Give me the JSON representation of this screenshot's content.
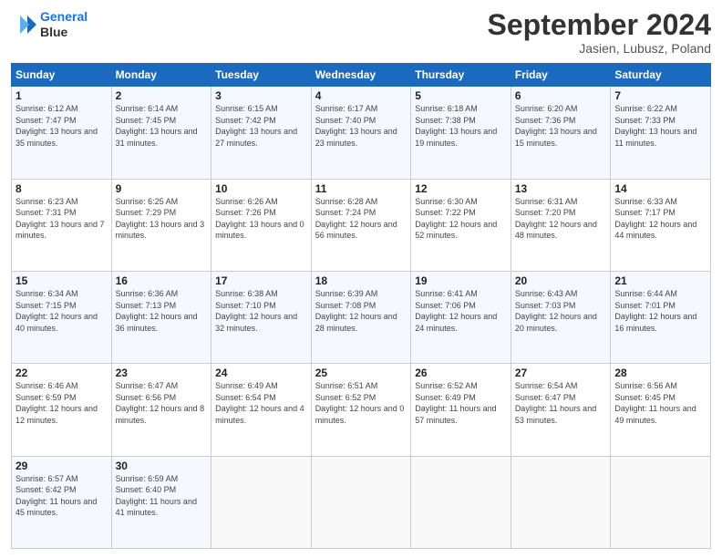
{
  "header": {
    "logo_line1": "General",
    "logo_line2": "Blue",
    "month": "September 2024",
    "location": "Jasien, Lubusz, Poland"
  },
  "days_of_week": [
    "Sunday",
    "Monday",
    "Tuesday",
    "Wednesday",
    "Thursday",
    "Friday",
    "Saturday"
  ],
  "weeks": [
    [
      {
        "day": "1",
        "sunrise": "6:12 AM",
        "sunset": "7:47 PM",
        "daylight": "13 hours and 35 minutes."
      },
      {
        "day": "2",
        "sunrise": "6:14 AM",
        "sunset": "7:45 PM",
        "daylight": "13 hours and 31 minutes."
      },
      {
        "day": "3",
        "sunrise": "6:15 AM",
        "sunset": "7:42 PM",
        "daylight": "13 hours and 27 minutes."
      },
      {
        "day": "4",
        "sunrise": "6:17 AM",
        "sunset": "7:40 PM",
        "daylight": "13 hours and 23 minutes."
      },
      {
        "day": "5",
        "sunrise": "6:18 AM",
        "sunset": "7:38 PM",
        "daylight": "13 hours and 19 minutes."
      },
      {
        "day": "6",
        "sunrise": "6:20 AM",
        "sunset": "7:36 PM",
        "daylight": "13 hours and 15 minutes."
      },
      {
        "day": "7",
        "sunrise": "6:22 AM",
        "sunset": "7:33 PM",
        "daylight": "13 hours and 11 minutes."
      }
    ],
    [
      {
        "day": "8",
        "sunrise": "6:23 AM",
        "sunset": "7:31 PM",
        "daylight": "13 hours and 7 minutes."
      },
      {
        "day": "9",
        "sunrise": "6:25 AM",
        "sunset": "7:29 PM",
        "daylight": "13 hours and 3 minutes."
      },
      {
        "day": "10",
        "sunrise": "6:26 AM",
        "sunset": "7:26 PM",
        "daylight": "13 hours and 0 minutes."
      },
      {
        "day": "11",
        "sunrise": "6:28 AM",
        "sunset": "7:24 PM",
        "daylight": "12 hours and 56 minutes."
      },
      {
        "day": "12",
        "sunrise": "6:30 AM",
        "sunset": "7:22 PM",
        "daylight": "12 hours and 52 minutes."
      },
      {
        "day": "13",
        "sunrise": "6:31 AM",
        "sunset": "7:20 PM",
        "daylight": "12 hours and 48 minutes."
      },
      {
        "day": "14",
        "sunrise": "6:33 AM",
        "sunset": "7:17 PM",
        "daylight": "12 hours and 44 minutes."
      }
    ],
    [
      {
        "day": "15",
        "sunrise": "6:34 AM",
        "sunset": "7:15 PM",
        "daylight": "12 hours and 40 minutes."
      },
      {
        "day": "16",
        "sunrise": "6:36 AM",
        "sunset": "7:13 PM",
        "daylight": "12 hours and 36 minutes."
      },
      {
        "day": "17",
        "sunrise": "6:38 AM",
        "sunset": "7:10 PM",
        "daylight": "12 hours and 32 minutes."
      },
      {
        "day": "18",
        "sunrise": "6:39 AM",
        "sunset": "7:08 PM",
        "daylight": "12 hours and 28 minutes."
      },
      {
        "day": "19",
        "sunrise": "6:41 AM",
        "sunset": "7:06 PM",
        "daylight": "12 hours and 24 minutes."
      },
      {
        "day": "20",
        "sunrise": "6:43 AM",
        "sunset": "7:03 PM",
        "daylight": "12 hours and 20 minutes."
      },
      {
        "day": "21",
        "sunrise": "6:44 AM",
        "sunset": "7:01 PM",
        "daylight": "12 hours and 16 minutes."
      }
    ],
    [
      {
        "day": "22",
        "sunrise": "6:46 AM",
        "sunset": "6:59 PM",
        "daylight": "12 hours and 12 minutes."
      },
      {
        "day": "23",
        "sunrise": "6:47 AM",
        "sunset": "6:56 PM",
        "daylight": "12 hours and 8 minutes."
      },
      {
        "day": "24",
        "sunrise": "6:49 AM",
        "sunset": "6:54 PM",
        "daylight": "12 hours and 4 minutes."
      },
      {
        "day": "25",
        "sunrise": "6:51 AM",
        "sunset": "6:52 PM",
        "daylight": "12 hours and 0 minutes."
      },
      {
        "day": "26",
        "sunrise": "6:52 AM",
        "sunset": "6:49 PM",
        "daylight": "11 hours and 57 minutes."
      },
      {
        "day": "27",
        "sunrise": "6:54 AM",
        "sunset": "6:47 PM",
        "daylight": "11 hours and 53 minutes."
      },
      {
        "day": "28",
        "sunrise": "6:56 AM",
        "sunset": "6:45 PM",
        "daylight": "11 hours and 49 minutes."
      }
    ],
    [
      {
        "day": "29",
        "sunrise": "6:57 AM",
        "sunset": "6:42 PM",
        "daylight": "11 hours and 45 minutes."
      },
      {
        "day": "30",
        "sunrise": "6:59 AM",
        "sunset": "6:40 PM",
        "daylight": "11 hours and 41 minutes."
      },
      null,
      null,
      null,
      null,
      null
    ]
  ]
}
